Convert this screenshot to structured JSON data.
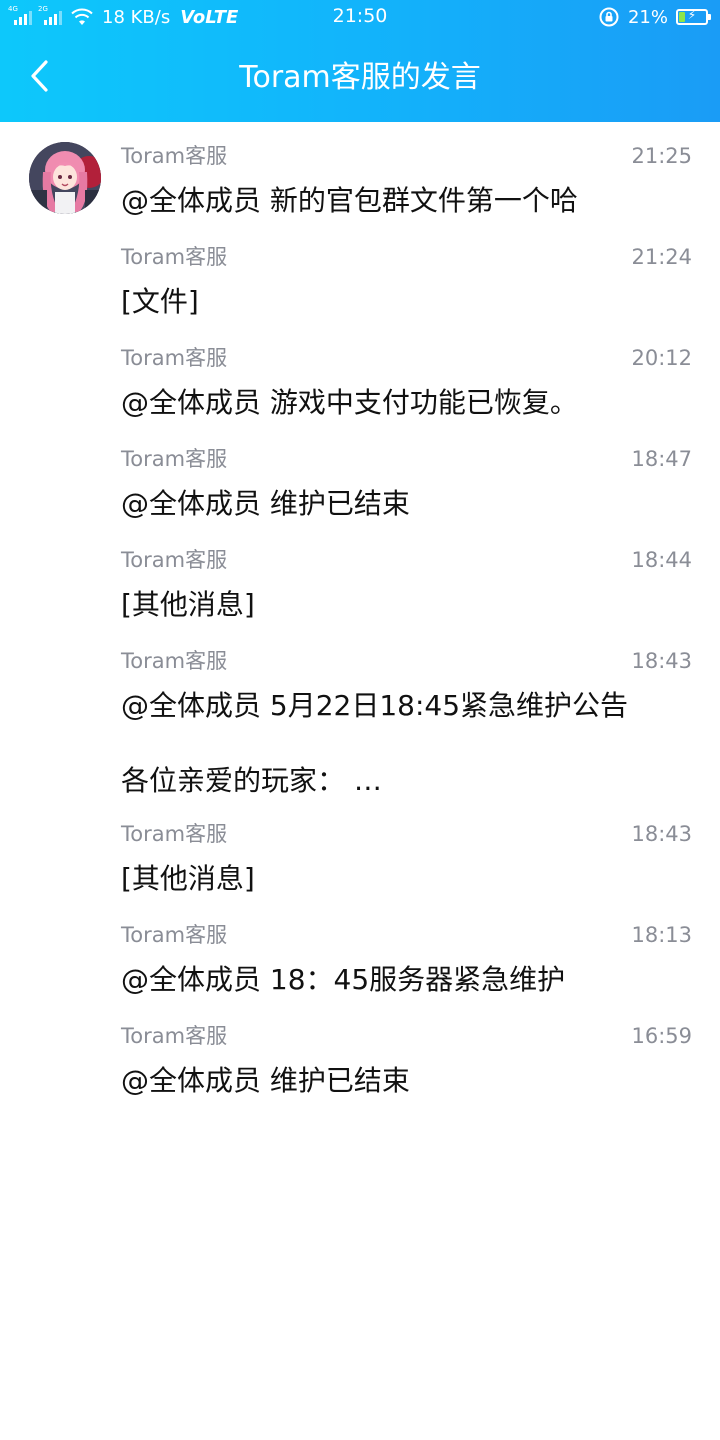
{
  "status_bar": {
    "net_4g": "4G",
    "net_2g": "2G",
    "speed": "18 KB/s",
    "volte": "VoLTE",
    "time": "21:50",
    "battery_pct": "21%",
    "battery_level": 0.21,
    "icons": [
      "signal-icon",
      "wifi-icon",
      "rotation-lock-icon",
      "battery-charging-icon"
    ]
  },
  "header": {
    "title": "Toram客服的发言",
    "back_icon": "chevron-left-icon"
  },
  "colors": {
    "header_start": "#0dc8fb",
    "header_end": "#1a9cf6",
    "meta_text": "#8a8d96",
    "body_text": "#111111"
  },
  "messages": [
    {
      "sender": "Toram客服",
      "time": "21:25",
      "text": "@全体成员 新的官包群文件第一个哈",
      "text2": ""
    },
    {
      "sender": "Toram客服",
      "time": "21:24",
      "text": "[文件]",
      "text2": ""
    },
    {
      "sender": "Toram客服",
      "time": "20:12",
      "text": "@全体成员 游戏中支付功能已恢复。",
      "text2": ""
    },
    {
      "sender": "Toram客服",
      "time": "18:47",
      "text": "@全体成员 维护已结束",
      "text2": ""
    },
    {
      "sender": "Toram客服",
      "time": "18:44",
      "text": "[其他消息]",
      "text2": ""
    },
    {
      "sender": "Toram客服",
      "time": "18:43",
      "text": "@全体成员 5月22日18:45紧急维护公告",
      "text2": "各位亲爱的玩家： …"
    },
    {
      "sender": "Toram客服",
      "time": "18:43",
      "text": "[其他消息]",
      "text2": ""
    },
    {
      "sender": "Toram客服",
      "time": "18:13",
      "text": "@全体成员 18：45服务器紧急维护",
      "text2": ""
    },
    {
      "sender": "Toram客服",
      "time": "16:59",
      "text": "@全体成员 维护已结束",
      "text2": ""
    }
  ]
}
